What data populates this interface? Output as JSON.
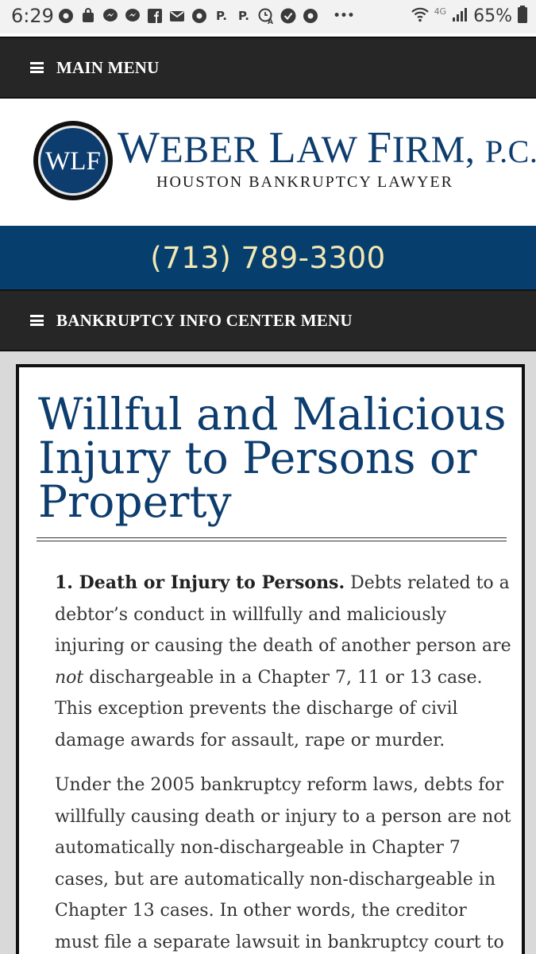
{
  "status_bar": {
    "time": "6:29",
    "network": "4G",
    "battery": "65%",
    "notifications": [
      {
        "icon": "chrome-icon"
      },
      {
        "icon": "shopping-bag-icon"
      },
      {
        "icon": "messenger-icon"
      },
      {
        "icon": "messenger-icon"
      },
      {
        "icon": "facebook-icon"
      },
      {
        "icon": "mail-icon"
      },
      {
        "icon": "chrome-icon"
      },
      {
        "icon": "p-icon",
        "text": "P."
      },
      {
        "icon": "p-icon",
        "text": "P."
      },
      {
        "icon": "clock-a-icon"
      },
      {
        "icon": "check-circle-icon"
      },
      {
        "icon": "chrome-icon"
      },
      {
        "icon": "more-icon",
        "text": "•••"
      }
    ]
  },
  "main_menu": {
    "label": "MAIN MENU"
  },
  "logo": {
    "seal_text": "WLF",
    "name_parts": [
      "W",
      "EBER ",
      "L",
      "AW ",
      "F",
      "IRM, ",
      "P.C."
    ],
    "tagline": "HOUSTON BANKRUPTCY LAWYER"
  },
  "phone": {
    "number": "(713) 789-3300"
  },
  "info_menu": {
    "label": "BANKRUPTCY INFO CENTER MENU"
  },
  "article": {
    "title": "Willful and Malicious Injury to Persons or Property",
    "p1_heading": "1. Death or Injury to Persons.",
    "p1_a": " Debts related to a debtor’s conduct in willfully and maliciously injuring or causing the death of another person are ",
    "p1_em": "not",
    "p1_b": " dischargeable in a Chapter 7, 11 or 13 case. This exception prevents the discharge of civil damage awards for assault, rape or murder.",
    "p2": "Under the 2005 bankruptcy reform laws, debts for willfully causing death or injury to a person are not automatically non-dischargeable in Chapter 7 cases, but are automatically non-dischargeable in Chapter 13 cases. In other words, the creditor must file a separate lawsuit in bankruptcy court to"
  },
  "colors": {
    "brand_blue": "#0d3d6e",
    "phone_bar": "#063f6e",
    "phone_text": "#f3e8b4",
    "menu_bar": "#262626"
  }
}
